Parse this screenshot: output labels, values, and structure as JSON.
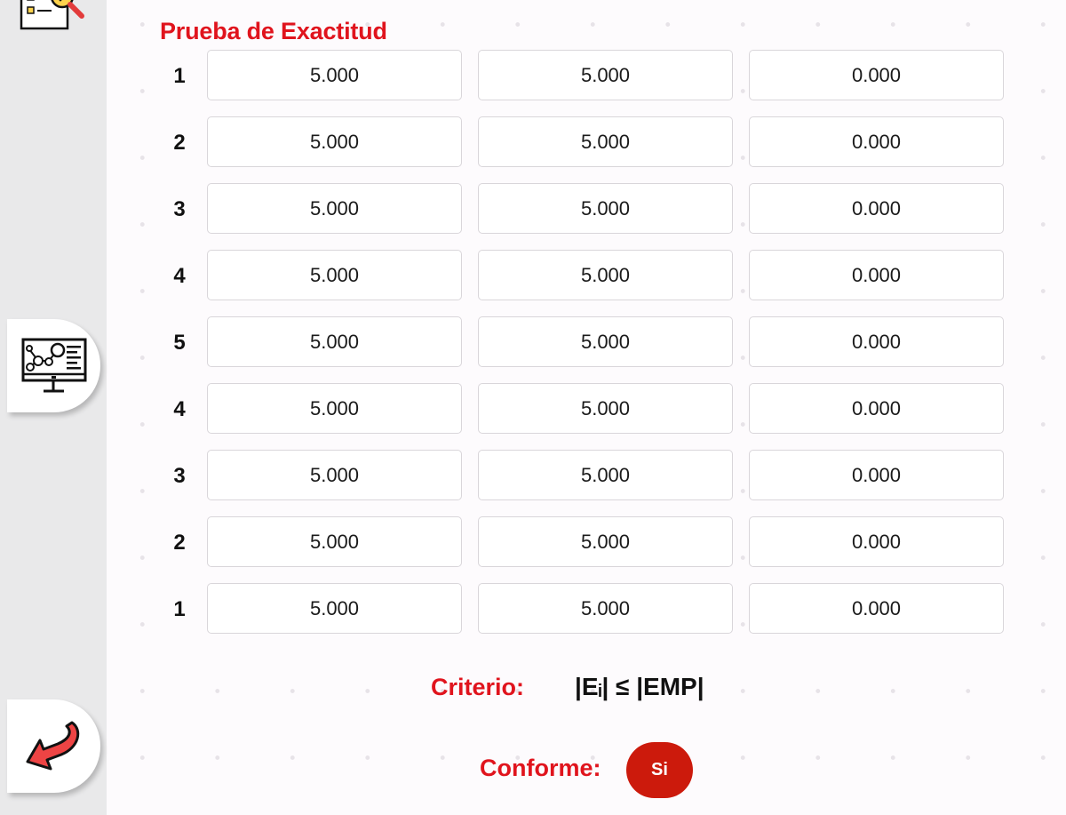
{
  "title": "Prueba de Exactitud",
  "rows": [
    {
      "index": "1",
      "v1": "5.000",
      "v2": "5.000",
      "v3": "0.000"
    },
    {
      "index": "2",
      "v1": "5.000",
      "v2": "5.000",
      "v3": "0.000"
    },
    {
      "index": "3",
      "v1": "5.000",
      "v2": "5.000",
      "v3": "0.000"
    },
    {
      "index": "4",
      "v1": "5.000",
      "v2": "5.000",
      "v3": "0.000"
    },
    {
      "index": "5",
      "v1": "5.000",
      "v2": "5.000",
      "v3": "0.000"
    },
    {
      "index": "4",
      "v1": "5.000",
      "v2": "5.000",
      "v3": "0.000"
    },
    {
      "index": "3",
      "v1": "5.000",
      "v2": "5.000",
      "v3": "0.000"
    },
    {
      "index": "2",
      "v1": "5.000",
      "v2": "5.000",
      "v3": "0.000"
    },
    {
      "index": "1",
      "v1": "5.000",
      "v2": "5.000",
      "v3": "0.000"
    }
  ],
  "criterio": {
    "label": "Criterio:",
    "value": "|Eᵢ| ≤ |EMP|"
  },
  "conforme": {
    "label": "Conforme:",
    "value": "Si"
  },
  "sidebar": {
    "icons": [
      "checklist-magnifier-icon",
      "monitor-network-icon",
      "back-arrow-icon"
    ]
  },
  "colors": {
    "accent_red": "#e0141d",
    "badge_red": "#cc1a0c",
    "sidebar_bg": "#e9e9ea"
  }
}
